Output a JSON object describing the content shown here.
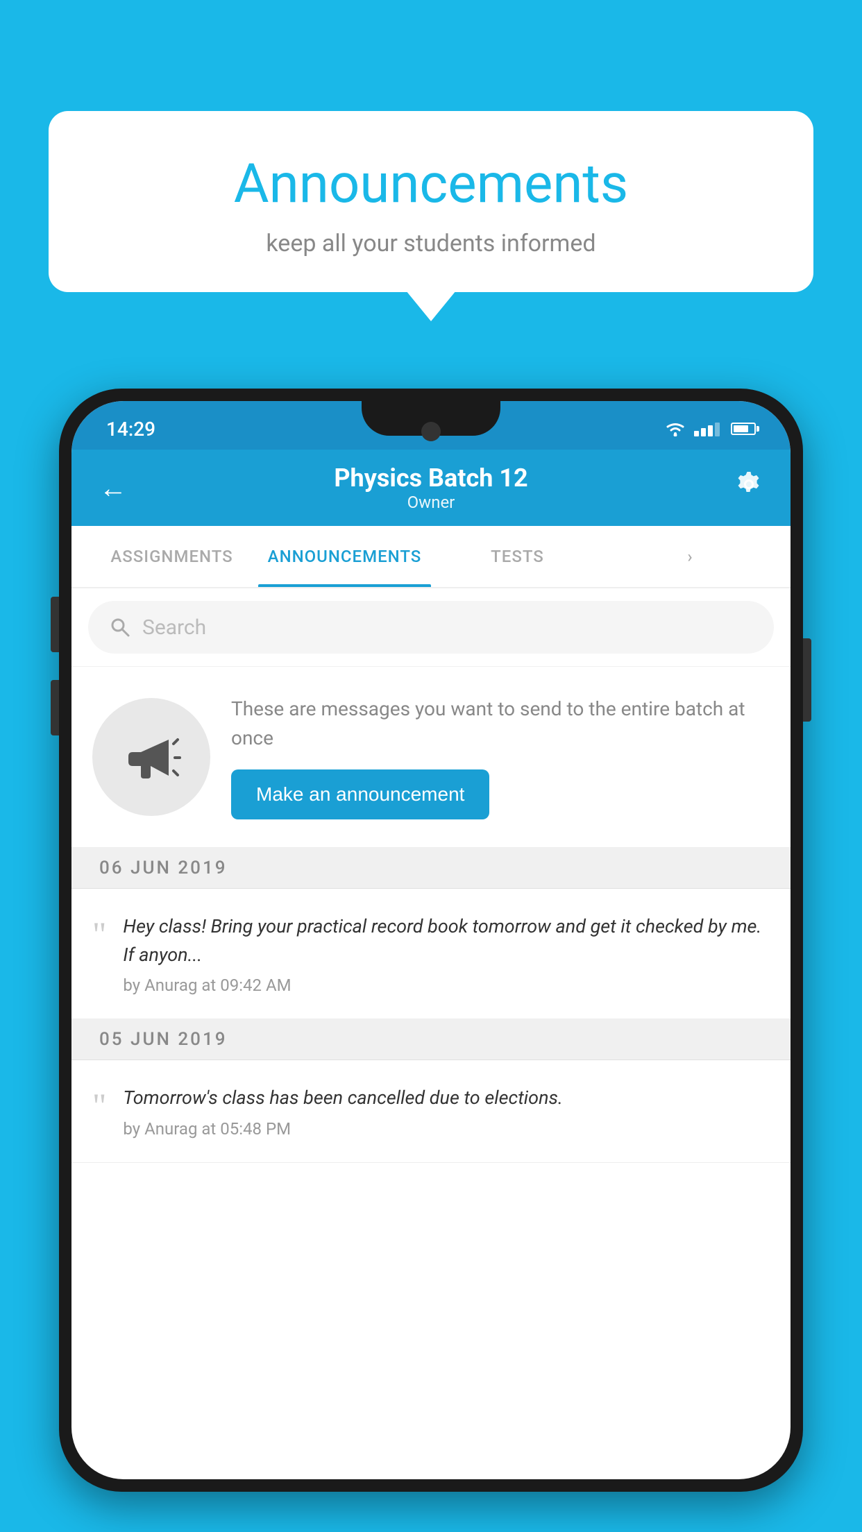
{
  "bubble": {
    "title": "Announcements",
    "subtitle": "keep all your students informed"
  },
  "statusBar": {
    "time": "14:29",
    "icons": [
      "wifi",
      "signal",
      "battery"
    ]
  },
  "appHeader": {
    "title": "Physics Batch 12",
    "subtitle": "Owner",
    "backLabel": "←",
    "settingsLabel": "⚙"
  },
  "tabs": [
    {
      "label": "ASSIGNMENTS",
      "active": false
    },
    {
      "label": "ANNOUNCEMENTS",
      "active": true
    },
    {
      "label": "TESTS",
      "active": false
    },
    {
      "label": "",
      "active": false
    }
  ],
  "search": {
    "placeholder": "Search"
  },
  "promo": {
    "text": "These are messages you want to send to the entire batch at once",
    "buttonLabel": "Make an announcement"
  },
  "announcements": [
    {
      "date": "06  JUN  2019",
      "text": "Hey class! Bring your practical record book tomorrow and get it checked by me. If anyon...",
      "meta": "by Anurag at 09:42 AM"
    },
    {
      "date": "05  JUN  2019",
      "text": "Tomorrow's class has been cancelled due to elections.",
      "meta": "by Anurag at 05:48 PM"
    }
  ]
}
